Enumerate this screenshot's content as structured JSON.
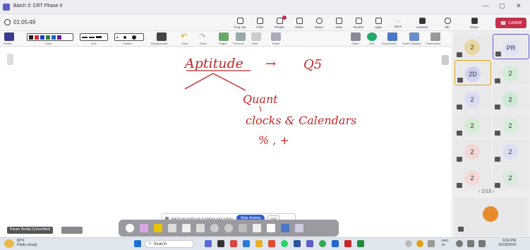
{
  "window": {
    "title": "Batch 3: CRT Phase II",
    "min": "—",
    "max": "▢",
    "close": "✕"
  },
  "meeting": {
    "timer": "01:05:49",
    "buttons": [
      {
        "label": "Pop out"
      },
      {
        "label": "Chat"
      },
      {
        "label": "People"
      },
      {
        "label": "Raise"
      },
      {
        "label": "React"
      },
      {
        "label": "View"
      },
      {
        "label": "Rooms"
      },
      {
        "label": "Apps"
      },
      {
        "label": "More"
      },
      {
        "label": "Camera"
      },
      {
        "label": "Mic"
      },
      {
        "label": "Share"
      }
    ],
    "leave": "Leave"
  },
  "toolbar": {
    "labels": [
      "Stroke",
      "Color",
      "Line",
      "Eraser",
      "Backgrounds",
      "Undo",
      "Redo",
      "Pages",
      "Previous",
      "Next",
      "Erase",
      "Share",
      "Grid",
      "Documents",
      "Share Desktop",
      "Screenshot"
    ]
  },
  "board": {
    "line1": "Aptitude",
    "arrow": "→",
    "line1b": "Q5",
    "line2": "Quant",
    "line3": "clocks & Calendars",
    "line4": "% , +"
  },
  "share": {
    "message": "teams.microsoft.com is sharing your screen.",
    "stop": "Stop sharing",
    "hide": "Hide"
  },
  "presenter": {
    "name": "Pavan Reddy (Unverified)"
  },
  "participants": [
    {
      "label": "2",
      "color": "#e9d7a0"
    },
    {
      "label": "PR",
      "color": "#dfe3f7"
    },
    {
      "label": "2D",
      "color": "#cfd3ef"
    },
    {
      "label": "2",
      "color": "#d3ecd6"
    },
    {
      "label": "2",
      "color": "#d9dcf2"
    },
    {
      "label": "2",
      "color": "#cde9d3"
    },
    {
      "label": "2",
      "color": "#d4ecd0"
    },
    {
      "label": "2",
      "color": "#d6eed8"
    },
    {
      "label": "2",
      "color": "#f1d7d5"
    },
    {
      "label": "2",
      "color": "#dde0f2"
    },
    {
      "label": "2",
      "color": "#f2d9d6"
    },
    {
      "label": "2",
      "color": "#d9eadc"
    }
  ],
  "pager": "1/13",
  "taskbar": {
    "weather_temp": "82°F",
    "weather_desc": "Partly cloudy",
    "search": "Search",
    "lang1": "ENG",
    "lang2": "IN",
    "time": "6:54 PM",
    "date": "10/23/2024"
  }
}
